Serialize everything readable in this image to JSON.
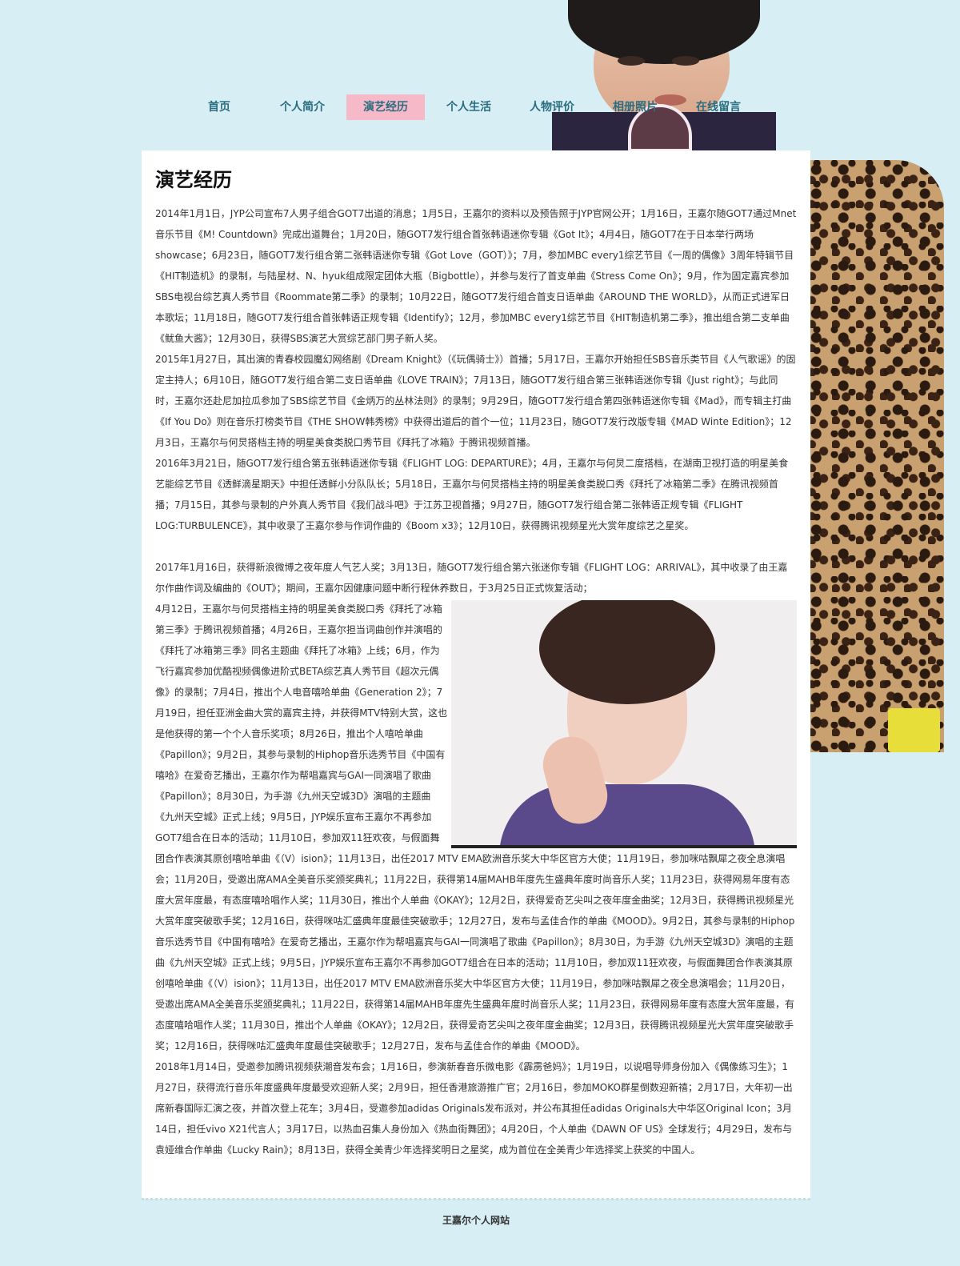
{
  "nav": {
    "items": [
      {
        "label": "首页"
      },
      {
        "label": "个人简介"
      },
      {
        "label": "演艺经历"
      },
      {
        "label": "个人生活"
      },
      {
        "label": "人物评价"
      },
      {
        "label": "相册照片"
      },
      {
        "label": "在线留言"
      }
    ],
    "active_index": 2,
    "active_color": "#f6b9c8",
    "text_color": "#2b6d80"
  },
  "main": {
    "title": "演艺经历",
    "paragraphs": [
      "2014年1月1日，JYP公司宣布7人男子组合GOT7出道的消息；1月5日，王嘉尔的资料以及预告照于JYP官网公开；1月16日，王嘉尔随GOT7通过Mnet音乐节目《M! Countdown》完成出道舞台；1月20日，随GOT7发行组合首张韩语迷你专辑《Got It》；4月4日，随GOT7在于日本举行两场showcase；6月23日，随GOT7发行组合第二张韩语迷你专辑《Got Love（GOT）》；7月，参加MBC every1综艺节目《一周的偶像》3周年特辑节目《HIT制造机》的录制，与陆星材、N、hyuk组成限定团体大瓶（Bigbottle），并参与发行了首支单曲《Stress Come On》；9月，作为固定嘉宾参加SBS电视台综艺真人秀节目《Roommate第二季》的录制；10月22日，随GOT7发行组合首支日语单曲《AROUND THE WORLD》，从而正式进军日本歌坛；11月18日，随GOT7发行组合首张韩语正规专辑《Identify》；12月，参加MBC every1综艺节目《HIT制造机第二季》，推出组合第二支单曲《鱿鱼大酱》；12月30日，获得SBS演艺大赏综艺部门男子新人奖。",
      "2015年1月27日，其出演的青春校园魔幻网络剧《Dream Knight》（《玩偶骑士》）首播；5月17日，王嘉尔开始担任SBS音乐类节目《人气歌谣》的固定主持人；6月10日，随GOT7发行组合第二支日语单曲《LOVE TRAIN》；7月13日，随GOT7发行组合第三张韩语迷你专辑《Just right》；与此同时，王嘉尔还赴尼加拉瓜参加了SBS综艺节目《金炳万的丛林法则》的录制；9月29日，随GOT7发行组合第四张韩语迷你专辑《Mad》，而专辑主打曲《If You Do》则在音乐打榜类节目《THE SHOW韩秀榜》中获得出道后的首个一位；11月23日，随GOT7发行改版专辑《MAD Winte Edition》；12月3日，王嘉尔与何炅搭档主持的明星美食类脱口秀节目《拜托了冰箱》于腾讯视频首播。",
      "2016年3月21日，随GOT7发行组合第五张韩语迷你专辑《FLIGHT LOG: DEPARTURE》；4月，王嘉尔与何炅二度搭档，在湖南卫视打造的明星美食艺能综艺节目《透鲜滴星期天》中担任透鲜小分队队长；5月18日，王嘉尔与何炅搭档主持的明星美食类脱口秀《拜托了冰箱第二季》在腾讯视频首播；7月15日，其参与录制的户外真人秀节目《我们战斗吧》于江苏卫视首播；9月27日，随GOT7发行组合第二张韩语正规专辑《FLIGHT LOG:TURBULENCE》，其中收录了王嘉尔参与作词作曲的《Boom x3》；12月10日，获得腾讯视频星光大赏年度综艺之星奖。",
      "2017年1月16日，获得新浪微博之夜年度人气艺人奖；3月13日，随GOT7发行组合第六张迷你专辑《FLIGHT LOG：ARRIVAL》，其中收录了由王嘉尔作曲作词及编曲的《OUT》；期间，王嘉尔因健康问题中断行程休养数日，于3月25日正式恢复活动；",
      "4月12日，王嘉尔与何炅搭档主持的明星美食类脱口秀《拜托了冰箱第三季》于腾讯视频首播；4月26日，王嘉尔担当词曲创作并演唱的《拜托了冰箱第三季》同名主题曲《拜托了冰箱》上线；6月，作为飞行嘉宾参加优酷视频偶像进阶式BETA综艺真人秀节目《超次元偶像》的录制；7月4日，推出个人电音嘻哈单曲《Generation 2》；7月19日，担任亚洲金曲大赏的嘉宾主持，并获得MTV特别大赏，这也是他获得的第一个个人音乐奖项；8月26日，推出个人嘻哈单曲《Papillon》；9月2日，其参与录制的Hiphop音乐选秀节目《中国有嘻哈》在爱奇艺播出，王嘉尔作为帮唱嘉宾与GAI一同演唱了歌曲《Papillon》；8月30日，为手游《九州天空城3D》演唱的主题曲《九州天空城》正式上线；9月5日，JYP娱乐宣布王嘉尔不再参加GOT7组合在日本的活动；11月10日，参加双11狂欢夜，与假面舞团合作表演其原创嘻哈单曲《（V）ision》；11月13日，出任2017 MTV EMA欧洲音乐奖大中华区官方大使；11月19日，参加咪咕飘犀之夜全息演唱会；11月20日，受邀出席AMA全美音乐奖颁奖典礼；11月22日，获得第14届MAHB年度先生盛典年度时尚音乐人奖；11月23日，获得网易年度有态度大赏年度最，有态度嘻哈唱作人奖；11月30日，推出个人单曲《OKAY》；12月2日，获得爱奇艺尖叫之夜年度金曲奖；12月3日，获得腾讯视频星光大赏年度突破歌手奖；12月16日，获得咪咕汇盛典年度最佳突破歌手；12月27日，发布与孟佳合作的单曲《MOOD》。9月2日，其参与录制的Hiphop音乐选秀节目《中国有嘻哈》在爱奇艺播出，王嘉尔作为帮唱嘉宾与GAI一同演唱了歌曲《Papillon》；8月30日，为手游《九州天空城3D》演唱的主题曲《九州天空城》正式上线；9月5日，JYP娱乐宣布王嘉尔不再参加GOT7组合在日本的活动；11月10日，参加双11狂欢夜，与假面舞团合作表演其原创嘻哈单曲《（V）ision》；11月13日，出任2017 MTV EMA欧洲音乐奖大中华区官方大使；11月19日，参加咪咕飘犀之夜全息演唱会；11月20日，受邀出席AMA全美音乐奖颁奖典礼；11月22日，获得第14届MAHB年度先生盛典年度时尚音乐人奖；11月23日，获得网易年度有态度大赏年度最，有态度嘻哈唱作人奖；11月30日，推出个人单曲《OKAY》；12月2日，获得爱奇艺尖叫之夜年度金曲奖；12月3日，获得腾讯视频星光大赏年度突破歌手奖；12月16日，获得咪咕汇盛典年度最佳突破歌手；12月27日，发布与孟佳合作的单曲《MOOD》。",
      "2018年1月14日，受邀参加腾讯视频获潮音发布会；1月16日，参演新春音乐微电影《霹雳爸妈》；1月19日，以说唱导师身份加入《偶像练习生》；1月27日，获得流行音乐年度盛典年度最受欢迎新人奖；2月9日，担任香港旅游推广官；2月16日，参加MOKO群星倒数迎新禧；2月17日，大年初一出席新春国际汇演之夜，并首次登上花车；3月4日，受邀参加adidas Originals发布派对，并公布其担任adidas Originals大中华区Original Icon；3月14日，担任vivo X21代言人；3月17日，以热血召集人身份加入《热血街舞团》；4月20日，个人单曲《DAWN OF US》全球发行；4月29日，发布与袁娅维合作单曲《Lucky Rain》；8月13日，获得全美青少年选择奖明日之星奖，成为首位在全美青少年选择奖上获奖的中国人。"
    ]
  },
  "footer": {
    "text": "王嘉尔个人网站"
  },
  "colors": {
    "background": "#d7eef4",
    "content_bg": "#ffffff",
    "nav_active_bg": "#f6b9c8"
  }
}
